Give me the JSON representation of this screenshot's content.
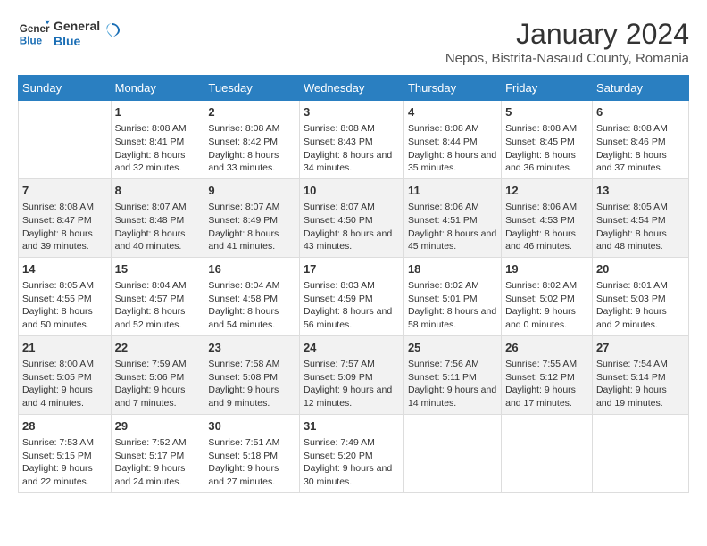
{
  "header": {
    "logo_line1": "General",
    "logo_line2": "Blue",
    "main_title": "January 2024",
    "subtitle": "Nepos, Bistrita-Nasaud County, Romania"
  },
  "calendar": {
    "weekdays": [
      "Sunday",
      "Monday",
      "Tuesday",
      "Wednesday",
      "Thursday",
      "Friday",
      "Saturday"
    ],
    "weeks": [
      [
        {
          "day": "",
          "sunrise": "",
          "sunset": "",
          "daylight": ""
        },
        {
          "day": "1",
          "sunrise": "Sunrise: 8:08 AM",
          "sunset": "Sunset: 8:41 PM",
          "daylight": "Daylight: 8 hours and 32 minutes."
        },
        {
          "day": "2",
          "sunrise": "Sunrise: 8:08 AM",
          "sunset": "Sunset: 8:42 PM",
          "daylight": "Daylight: 8 hours and 33 minutes."
        },
        {
          "day": "3",
          "sunrise": "Sunrise: 8:08 AM",
          "sunset": "Sunset: 8:43 PM",
          "daylight": "Daylight: 8 hours and 34 minutes."
        },
        {
          "day": "4",
          "sunrise": "Sunrise: 8:08 AM",
          "sunset": "Sunset: 8:44 PM",
          "daylight": "Daylight: 8 hours and 35 minutes."
        },
        {
          "day": "5",
          "sunrise": "Sunrise: 8:08 AM",
          "sunset": "Sunset: 8:45 PM",
          "daylight": "Daylight: 8 hours and 36 minutes."
        },
        {
          "day": "6",
          "sunrise": "Sunrise: 8:08 AM",
          "sunset": "Sunset: 8:46 PM",
          "daylight": "Daylight: 8 hours and 37 minutes."
        }
      ],
      [
        {
          "day": "7",
          "sunrise": "Sunrise: 8:08 AM",
          "sunset": "Sunset: 8:47 PM",
          "daylight": "Daylight: 8 hours and 39 minutes."
        },
        {
          "day": "8",
          "sunrise": "Sunrise: 8:07 AM",
          "sunset": "Sunset: 8:48 PM",
          "daylight": "Daylight: 8 hours and 40 minutes."
        },
        {
          "day": "9",
          "sunrise": "Sunrise: 8:07 AM",
          "sunset": "Sunset: 8:49 PM",
          "daylight": "Daylight: 8 hours and 41 minutes."
        },
        {
          "day": "10",
          "sunrise": "Sunrise: 8:07 AM",
          "sunset": "Sunset: 4:50 PM",
          "daylight": "Daylight: 8 hours and 43 minutes."
        },
        {
          "day": "11",
          "sunrise": "Sunrise: 8:06 AM",
          "sunset": "Sunset: 4:51 PM",
          "daylight": "Daylight: 8 hours and 45 minutes."
        },
        {
          "day": "12",
          "sunrise": "Sunrise: 8:06 AM",
          "sunset": "Sunset: 4:53 PM",
          "daylight": "Daylight: 8 hours and 46 minutes."
        },
        {
          "day": "13",
          "sunrise": "Sunrise: 8:05 AM",
          "sunset": "Sunset: 4:54 PM",
          "daylight": "Daylight: 8 hours and 48 minutes."
        }
      ],
      [
        {
          "day": "14",
          "sunrise": "Sunrise: 8:05 AM",
          "sunset": "Sunset: 4:55 PM",
          "daylight": "Daylight: 8 hours and 50 minutes."
        },
        {
          "day": "15",
          "sunrise": "Sunrise: 8:04 AM",
          "sunset": "Sunset: 4:57 PM",
          "daylight": "Daylight: 8 hours and 52 minutes."
        },
        {
          "day": "16",
          "sunrise": "Sunrise: 8:04 AM",
          "sunset": "Sunset: 4:58 PM",
          "daylight": "Daylight: 8 hours and 54 minutes."
        },
        {
          "day": "17",
          "sunrise": "Sunrise: 8:03 AM",
          "sunset": "Sunset: 4:59 PM",
          "daylight": "Daylight: 8 hours and 56 minutes."
        },
        {
          "day": "18",
          "sunrise": "Sunrise: 8:02 AM",
          "sunset": "Sunset: 5:01 PM",
          "daylight": "Daylight: 8 hours and 58 minutes."
        },
        {
          "day": "19",
          "sunrise": "Sunrise: 8:02 AM",
          "sunset": "Sunset: 5:02 PM",
          "daylight": "Daylight: 9 hours and 0 minutes."
        },
        {
          "day": "20",
          "sunrise": "Sunrise: 8:01 AM",
          "sunset": "Sunset: 5:03 PM",
          "daylight": "Daylight: 9 hours and 2 minutes."
        }
      ],
      [
        {
          "day": "21",
          "sunrise": "Sunrise: 8:00 AM",
          "sunset": "Sunset: 5:05 PM",
          "daylight": "Daylight: 9 hours and 4 minutes."
        },
        {
          "day": "22",
          "sunrise": "Sunrise: 7:59 AM",
          "sunset": "Sunset: 5:06 PM",
          "daylight": "Daylight: 9 hours and 7 minutes."
        },
        {
          "day": "23",
          "sunrise": "Sunrise: 7:58 AM",
          "sunset": "Sunset: 5:08 PM",
          "daylight": "Daylight: 9 hours and 9 minutes."
        },
        {
          "day": "24",
          "sunrise": "Sunrise: 7:57 AM",
          "sunset": "Sunset: 5:09 PM",
          "daylight": "Daylight: 9 hours and 12 minutes."
        },
        {
          "day": "25",
          "sunrise": "Sunrise: 7:56 AM",
          "sunset": "Sunset: 5:11 PM",
          "daylight": "Daylight: 9 hours and 14 minutes."
        },
        {
          "day": "26",
          "sunrise": "Sunrise: 7:55 AM",
          "sunset": "Sunset: 5:12 PM",
          "daylight": "Daylight: 9 hours and 17 minutes."
        },
        {
          "day": "27",
          "sunrise": "Sunrise: 7:54 AM",
          "sunset": "Sunset: 5:14 PM",
          "daylight": "Daylight: 9 hours and 19 minutes."
        }
      ],
      [
        {
          "day": "28",
          "sunrise": "Sunrise: 7:53 AM",
          "sunset": "Sunset: 5:15 PM",
          "daylight": "Daylight: 9 hours and 22 minutes."
        },
        {
          "day": "29",
          "sunrise": "Sunrise: 7:52 AM",
          "sunset": "Sunset: 5:17 PM",
          "daylight": "Daylight: 9 hours and 24 minutes."
        },
        {
          "day": "30",
          "sunrise": "Sunrise: 7:51 AM",
          "sunset": "Sunset: 5:18 PM",
          "daylight": "Daylight: 9 hours and 27 minutes."
        },
        {
          "day": "31",
          "sunrise": "Sunrise: 7:49 AM",
          "sunset": "Sunset: 5:20 PM",
          "daylight": "Daylight: 9 hours and 30 minutes."
        },
        {
          "day": "",
          "sunrise": "",
          "sunset": "",
          "daylight": ""
        },
        {
          "day": "",
          "sunrise": "",
          "sunset": "",
          "daylight": ""
        },
        {
          "day": "",
          "sunrise": "",
          "sunset": "",
          "daylight": ""
        }
      ]
    ]
  }
}
